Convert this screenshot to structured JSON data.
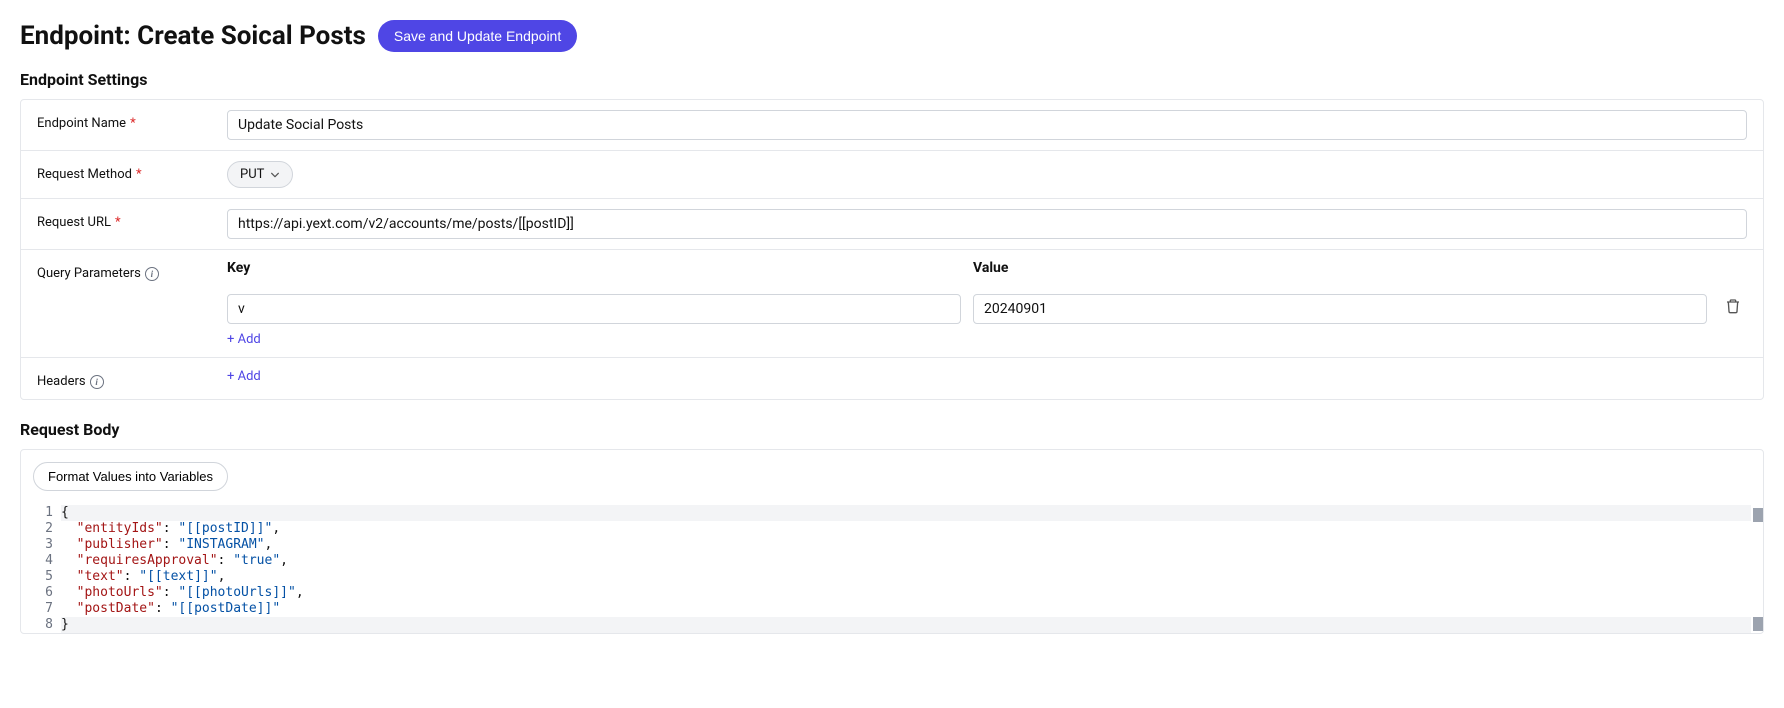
{
  "header": {
    "title": "Endpoint: Create Soical Posts",
    "save_button": "Save and Update Endpoint"
  },
  "sections": {
    "settings_title": "Endpoint Settings",
    "body_title": "Request Body"
  },
  "settings": {
    "endpoint_name_label": "Endpoint Name",
    "endpoint_name_value": "Update Social Posts",
    "request_method_label": "Request Method",
    "request_method_value": "PUT",
    "request_url_label": "Request URL",
    "request_url_value": "https://api.yext.com/v2/accounts/me/posts/[[postID]]",
    "query_params_label": "Query Parameters",
    "headers_label": "Headers",
    "key_header": "Key",
    "value_header": "Value",
    "query_params": [
      {
        "key": "v",
        "value": "20240901"
      }
    ],
    "add_link": "+ Add"
  },
  "body": {
    "format_button": "Format Values into Variables",
    "code_lines": [
      "{",
      "  \"entityIds\": \"[[postID]]\",",
      "  \"publisher\": \"INSTAGRAM\",",
      "  \"requiresApproval\": \"true\",",
      "  \"text\": \"[[text]]\",",
      "  \"photoUrls\": \"[[photoUrls]]\",",
      "  \"postDate\": \"[[postDate]]\"",
      "}"
    ]
  }
}
